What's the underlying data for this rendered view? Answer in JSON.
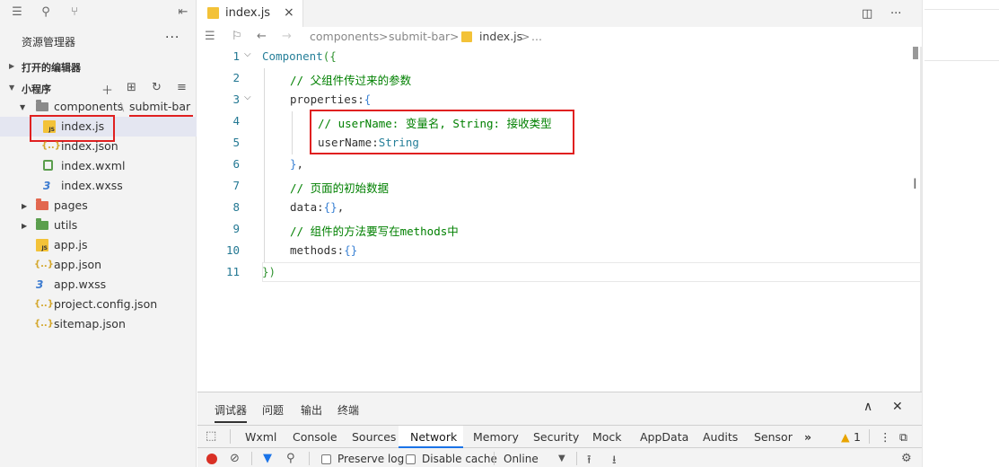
{
  "sidebar": {
    "explorer_title": "资源管理器",
    "more": "···",
    "open_editors": "打开的编辑器",
    "project": "小程序",
    "tree": [
      {
        "name": "components",
        "sep": "\\",
        "sub": "submit-bar",
        "type": "folder"
      },
      {
        "name": "index.js",
        "type": "js"
      },
      {
        "name": "index.json",
        "type": "json"
      },
      {
        "name": "index.wxml",
        "type": "wxml"
      },
      {
        "name": "index.wxss",
        "type": "wxss"
      },
      {
        "name": "pages",
        "type": "folder-red"
      },
      {
        "name": "utils",
        "type": "folder-green"
      },
      {
        "name": "app.js",
        "type": "js"
      },
      {
        "name": "app.json",
        "type": "json"
      },
      {
        "name": "app.wxss",
        "type": "wxss"
      },
      {
        "name": "project.config.json",
        "type": "json"
      },
      {
        "name": "sitemap.json",
        "type": "json"
      }
    ]
  },
  "editor": {
    "tab_label": "index.js",
    "tab_close": "×",
    "tab_more": "···",
    "breadcrumb": [
      "components",
      ">",
      "submit-bar",
      ">",
      "index.js",
      ">",
      "..."
    ],
    "line_numbers": [
      "1",
      "2",
      "3",
      "4",
      "5",
      "6",
      "7",
      "8",
      "9",
      "10",
      "11"
    ],
    "lines": {
      "l1_a": "Component",
      "l1_b": "({",
      "l2": "// 父组件传过来的参数",
      "l3_a": "properties:",
      "l3_b": "{",
      "l4": "// userName: 变量名, String: 接收类型",
      "l5_a": "userName:",
      "l5_b": "String",
      "l6_a": "}",
      "l6_b": ",",
      "l7": "// 页面的初始数据",
      "l8_a": "data:",
      "l8_b": "{}",
      "l8_c": ",",
      "l9": "// 组件的方法要写在methods中",
      "l10_a": "methods:",
      "l10_b": "{}",
      "l11": "})"
    }
  },
  "devtools": {
    "top_tabs": [
      "调试器",
      "问题",
      "输出",
      "终端"
    ],
    "tabs": [
      "Wxml",
      "Console",
      "Sources",
      "Network",
      "Memory",
      "Security",
      "Mock",
      "AppData",
      "Audits",
      "Sensor"
    ],
    "more_tabs": "»",
    "warning_count": "1",
    "preserve_log": "Preserve log",
    "disable_cache": "Disable cache",
    "throttle": "Online"
  },
  "colors": {
    "accent": "#1a73e8",
    "annotation_red": "#e02020",
    "comment": "#008000",
    "line_number": "#237893"
  }
}
